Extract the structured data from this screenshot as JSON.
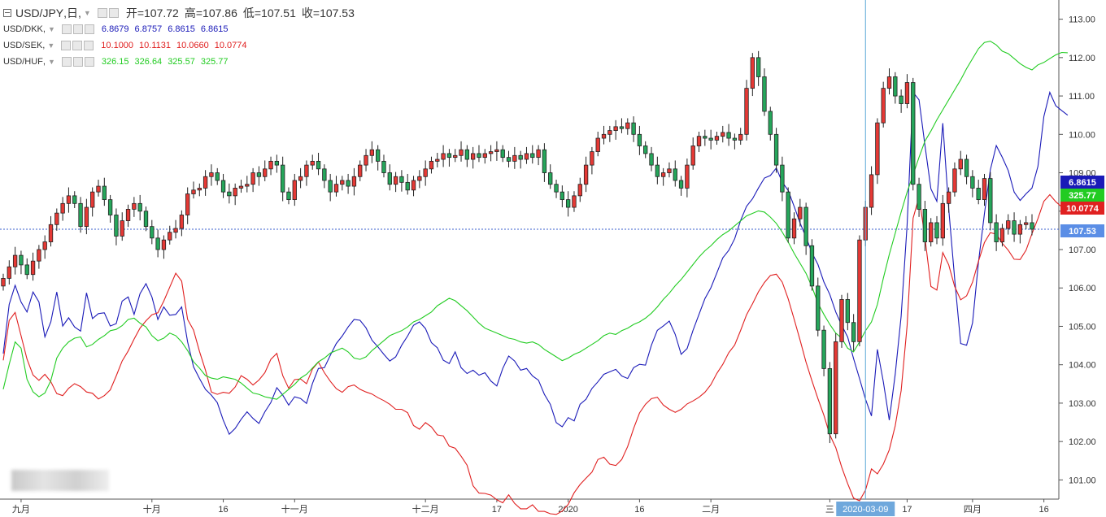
{
  "legend": {
    "main": {
      "symbol": "USD/JPY",
      "interval": "日",
      "o_label": "开=",
      "o": "107.72",
      "h_label": "高=",
      "h": "107.86",
      "l_label": "低=",
      "l": "107.51",
      "c_label": "收=",
      "c": "107.53"
    },
    "overlays": [
      {
        "symbol": "USD/DKK",
        "color": "#1a1ab8",
        "vals": [
          "6.8679",
          "6.8757",
          "6.8615",
          "6.8615"
        ]
      },
      {
        "symbol": "USD/SEK",
        "color": "#e02020",
        "vals": [
          "10.1000",
          "10.1131",
          "10.0660",
          "10.0774"
        ]
      },
      {
        "symbol": "USD/HUF",
        "color": "#22cc22",
        "vals": [
          "326.15",
          "326.64",
          "325.57",
          "325.77"
        ]
      }
    ]
  },
  "price_badges": [
    {
      "text": "6.8615",
      "color": "#1a1ab8",
      "y": 108.85
    },
    {
      "text": "325.77",
      "color": "#22cc22",
      "y": 108.5
    },
    {
      "text": "10.0774",
      "color": "#e02020",
      "y": 108.2
    },
    {
      "text": "107.53",
      "color": "#5b8ee6",
      "y": 107.53
    }
  ],
  "crosshair_label": "2020-03-09",
  "colors": {
    "up": "#e53935",
    "down": "#26a65b",
    "candle_border": "#222222",
    "dkk": "#1a1ab8",
    "sek": "#e02020",
    "huf": "#22cc22",
    "crosshair": "#5aa7d6",
    "last_line": "#3a5fcd"
  },
  "chart_data": {
    "type": "candlestick",
    "title": "USD/JPY, 日",
    "ylim": [
      100.5,
      113.5
    ],
    "yticks": [
      101,
      102,
      103,
      104,
      105,
      106,
      107,
      108,
      109,
      110,
      111,
      112,
      113
    ],
    "ytick_labels": [
      "101.00",
      "102.00",
      "103.00",
      "104.00",
      "105.00",
      "106.00",
      "107.00",
      "108.00",
      "109.00",
      "110.00",
      "111.00",
      "112.00",
      "113.00"
    ],
    "x_labels": [
      {
        "i": 3,
        "text": "九月"
      },
      {
        "i": 25,
        "text": "十月"
      },
      {
        "i": 37,
        "text": "16"
      },
      {
        "i": 49,
        "text": "十一月"
      },
      {
        "i": 71,
        "text": "十二月"
      },
      {
        "i": 83,
        "text": "17"
      },
      {
        "i": 95,
        "text": "2020"
      },
      {
        "i": 107,
        "text": "16"
      },
      {
        "i": 119,
        "text": "二月"
      },
      {
        "i": 139,
        "text": "三"
      },
      {
        "i": 152,
        "text": "17"
      },
      {
        "i": 163,
        "text": "四月"
      },
      {
        "i": 175,
        "text": "16"
      }
    ],
    "crosshair_index": 145,
    "last_close": 107.53,
    "usdjpy_close": [
      106.25,
      106.55,
      106.85,
      106.6,
      106.35,
      106.7,
      107.0,
      107.2,
      107.65,
      107.95,
      108.2,
      108.4,
      108.2,
      107.6,
      108.1,
      108.5,
      108.65,
      108.3,
      107.9,
      107.35,
      107.75,
      108.05,
      108.2,
      108.0,
      107.6,
      107.3,
      107.0,
      107.25,
      107.45,
      107.55,
      107.9,
      108.45,
      108.55,
      108.6,
      108.9,
      109.0,
      108.8,
      108.5,
      108.4,
      108.6,
      108.65,
      108.7,
      109.0,
      108.9,
      109.1,
      109.3,
      109.2,
      108.5,
      108.3,
      108.8,
      108.9,
      109.2,
      109.3,
      109.1,
      108.8,
      108.5,
      108.7,
      108.8,
      108.65,
      108.9,
      109.2,
      109.45,
      109.6,
      109.3,
      109.0,
      108.7,
      108.9,
      108.75,
      108.55,
      108.8,
      108.9,
      109.1,
      109.3,
      109.35,
      109.5,
      109.4,
      109.45,
      109.6,
      109.35,
      109.5,
      109.4,
      109.5,
      109.55,
      109.6,
      109.4,
      109.3,
      109.45,
      109.35,
      109.5,
      109.4,
      109.6,
      109.0,
      108.7,
      108.5,
      108.3,
      108.1,
      108.4,
      108.7,
      109.2,
      109.55,
      109.9,
      110.0,
      110.1,
      110.2,
      110.15,
      110.3,
      110.0,
      109.7,
      109.5,
      109.2,
      108.9,
      109.0,
      109.1,
      108.8,
      108.6,
      109.2,
      109.7,
      109.95,
      109.9,
      109.85,
      109.95,
      110.05,
      109.9,
      109.85,
      110.0,
      111.2,
      112.0,
      111.5,
      110.6,
      110.0,
      109.2,
      108.5,
      107.3,
      107.8,
      108.1,
      107.1,
      106.05,
      104.9,
      103.9,
      102.2,
      104.6,
      105.7,
      105.1,
      104.6,
      107.25,
      108.1,
      108.95,
      110.3,
      111.2,
      111.5,
      111.0,
      110.8,
      111.35,
      108.7,
      108.05,
      107.2,
      107.7,
      107.3,
      108.2,
      108.5,
      109.1,
      109.35,
      108.9,
      108.6,
      108.3,
      108.85,
      107.7,
      107.2,
      107.55,
      107.75,
      107.4,
      107.65,
      107.7,
      107.53
    ],
    "series": [
      {
        "name": "USD/DKK",
        "ylim": [
          6.4,
          7.0
        ],
        "values": [
          6.575,
          6.634,
          6.657,
          6.637,
          6.625,
          6.649,
          6.637,
          6.595,
          6.613,
          6.649,
          6.608,
          6.618,
          6.607,
          6.602,
          6.648,
          6.617,
          6.623,
          6.624,
          6.608,
          6.611,
          6.638,
          6.643,
          6.622,
          6.647,
          6.659,
          6.643,
          6.616,
          6.631,
          6.621,
          6.622,
          6.631,
          6.589,
          6.559,
          6.545,
          6.532,
          6.525,
          6.516,
          6.495,
          6.478,
          6.485,
          6.496,
          6.505,
          6.497,
          6.491,
          6.505,
          6.516,
          6.534,
          6.525,
          6.513,
          6.523,
          6.521,
          6.515,
          6.539,
          6.557,
          6.558,
          6.573,
          6.587,
          6.596,
          6.607,
          6.616,
          6.615,
          6.606,
          6.591,
          6.583,
          6.574,
          6.566,
          6.571,
          6.585,
          6.596,
          6.609,
          6.613,
          6.605,
          6.588,
          6.582,
          6.567,
          6.563,
          6.577,
          6.558,
          6.551,
          6.555,
          6.549,
          6.552,
          6.542,
          6.536,
          6.557,
          6.572,
          6.566,
          6.555,
          6.557,
          6.548,
          6.543,
          6.526,
          6.514,
          6.492,
          6.487,
          6.498,
          6.494,
          6.514,
          6.52,
          6.533,
          6.541,
          6.55,
          6.553,
          6.556,
          6.548,
          6.545,
          6.558,
          6.562,
          6.561,
          6.585,
          6.603,
          6.608,
          6.614,
          6.598,
          6.574,
          6.581,
          6.603,
          6.622,
          6.641,
          6.654,
          6.672,
          6.69,
          6.699,
          6.713,
          6.735,
          6.752,
          6.761,
          6.774,
          6.786,
          6.789,
          6.798,
          6.781,
          6.771,
          6.752,
          6.732,
          6.715,
          6.696,
          6.682,
          6.661,
          6.646,
          6.625,
          6.609,
          6.595,
          6.569,
          6.545,
          6.52,
          6.5,
          6.58,
          6.541,
          6.495,
          6.55,
          6.62,
          6.729,
          6.889,
          6.88,
          6.825,
          6.773,
          6.758,
          6.852,
          6.749,
          6.665,
          6.587,
          6.585,
          6.612,
          6.685,
          6.743,
          6.796,
          6.825,
          6.811,
          6.795,
          6.769,
          6.759,
          6.767,
          6.774,
          6.8,
          6.86,
          6.889,
          6.873,
          6.867,
          6.8615
        ]
      },
      {
        "name": "USD/SEK",
        "ylim": [
          9.2,
          10.7
        ],
        "values": [
          9.617,
          9.737,
          9.761,
          9.691,
          9.621,
          9.573,
          9.557,
          9.575,
          9.553,
          9.517,
          9.511,
          9.533,
          9.547,
          9.538,
          9.522,
          9.518,
          9.501,
          9.511,
          9.528,
          9.57,
          9.615,
          9.645,
          9.681,
          9.714,
          9.736,
          9.754,
          9.76,
          9.795,
          9.837,
          9.879,
          9.855,
          9.74,
          9.708,
          9.644,
          9.588,
          9.522,
          9.515,
          9.521,
          9.518,
          9.537,
          9.571,
          9.56,
          9.543,
          9.558,
          9.58,
          9.62,
          9.638,
          9.571,
          9.533,
          9.559,
          9.561,
          9.547,
          9.591,
          9.612,
          9.58,
          9.554,
          9.532,
          9.521,
          9.538,
          9.543,
          9.53,
          9.522,
          9.516,
          9.505,
          9.496,
          9.485,
          9.47,
          9.47,
          9.46,
          9.421,
          9.41,
          9.43,
          9.417,
          9.393,
          9.39,
          9.359,
          9.353,
          9.329,
          9.302,
          9.24,
          9.218,
          9.217,
          9.212,
          9.198,
          9.189,
          9.213,
          9.187,
          9.171,
          9.171,
          9.183,
          9.163,
          9.163,
          9.156,
          9.154,
          9.164,
          9.184,
          9.219,
          9.244,
          9.263,
          9.281,
          9.319,
          9.326,
          9.305,
          9.301,
          9.319,
          9.358,
          9.412,
          9.459,
          9.485,
          9.502,
          9.506,
          9.483,
          9.47,
          9.461,
          9.47,
          9.486,
          9.495,
          9.506,
          9.521,
          9.544,
          9.578,
          9.605,
          9.64,
          9.663,
          9.707,
          9.754,
          9.787,
          9.823,
          9.851,
          9.872,
          9.876,
          9.852,
          9.802,
          9.741,
          9.678,
          9.612,
          9.555,
          9.502,
          9.452,
          9.393,
          9.355,
          9.296,
          9.247,
          9.203,
          9.195,
          9.227,
          9.291,
          9.276,
          9.305,
          9.348,
          9.42,
          9.526,
          9.72,
          10.044,
          10.108,
          9.986,
          9.839,
          9.828,
          9.941,
          9.904,
          9.839,
          9.799,
          9.811,
          9.852,
          9.915,
          9.971,
          10.001,
          9.996,
          9.969,
          9.948,
          9.921,
          9.92,
          9.948,
          9.998,
          10.043,
          10.095,
          10.115,
          10.094,
          10.078,
          10.0774
        ]
      },
      {
        "name": "USD/HUF",
        "ylim": [
          290,
          330
        ],
        "values": [
          298.8,
          300.8,
          302.6,
          302.1,
          299.6,
          298.6,
          298.2,
          298.5,
          299.5,
          301.3,
          302.1,
          302.6,
          302.9,
          303.0,
          302.2,
          302.4,
          302.8,
          303.1,
          303.5,
          303.6,
          303.9,
          304.4,
          304.5,
          304.1,
          303.8,
          303.1,
          302.7,
          302.9,
          303.3,
          303.1,
          302.6,
          301.9,
          301.0,
          300.5,
          299.9,
          299.7,
          299.6,
          299.8,
          299.7,
          299.6,
          299.3,
          298.9,
          298.5,
          298.4,
          298.2,
          298.1,
          298.0,
          298.4,
          298.8,
          299.2,
          299.7,
          300.0,
          300.5,
          301.0,
          301.3,
          301.7,
          301.9,
          302.1,
          301.8,
          301.3,
          301.2,
          301.4,
          301.9,
          302.3,
          302.7,
          303.1,
          303.3,
          303.5,
          303.8,
          304.2,
          304.4,
          304.7,
          305.0,
          305.5,
          305.8,
          306.1,
          305.9,
          305.5,
          305.1,
          304.6,
          304.1,
          303.7,
          303.5,
          303.3,
          303.1,
          302.9,
          302.8,
          302.6,
          302.5,
          302.6,
          302.4,
          302.0,
          301.7,
          301.4,
          301.1,
          301.3,
          301.6,
          301.8,
          302.1,
          302.4,
          302.7,
          303.1,
          303.3,
          303.2,
          303.5,
          303.7,
          304.0,
          304.2,
          304.5,
          304.9,
          305.4,
          306.0,
          306.5,
          307.1,
          307.6,
          308.2,
          308.8,
          309.4,
          309.9,
          310.3,
          310.8,
          311.2,
          311.5,
          311.9,
          312.3,
          312.7,
          312.9,
          313.1,
          313.0,
          312.6,
          312.1,
          311.4,
          310.6,
          309.7,
          308.9,
          308.1,
          307.0,
          305.7,
          304.8,
          304.0,
          303.3,
          302.9,
          302.1,
          301.8,
          302.6,
          303.5,
          304.2,
          305.6,
          307.7,
          309.6,
          311.3,
          313.0,
          314.6,
          316.0,
          317.4,
          318.7,
          319.5,
          320.4,
          321.2,
          322.0,
          322.8,
          323.6,
          324.5,
          325.3,
          326.1,
          326.6,
          326.7,
          326.4,
          325.9,
          325.7,
          325.3,
          324.9,
          324.6,
          324.4,
          324.8,
          325.0,
          325.3,
          325.6,
          325.8,
          325.77
        ]
      }
    ]
  }
}
